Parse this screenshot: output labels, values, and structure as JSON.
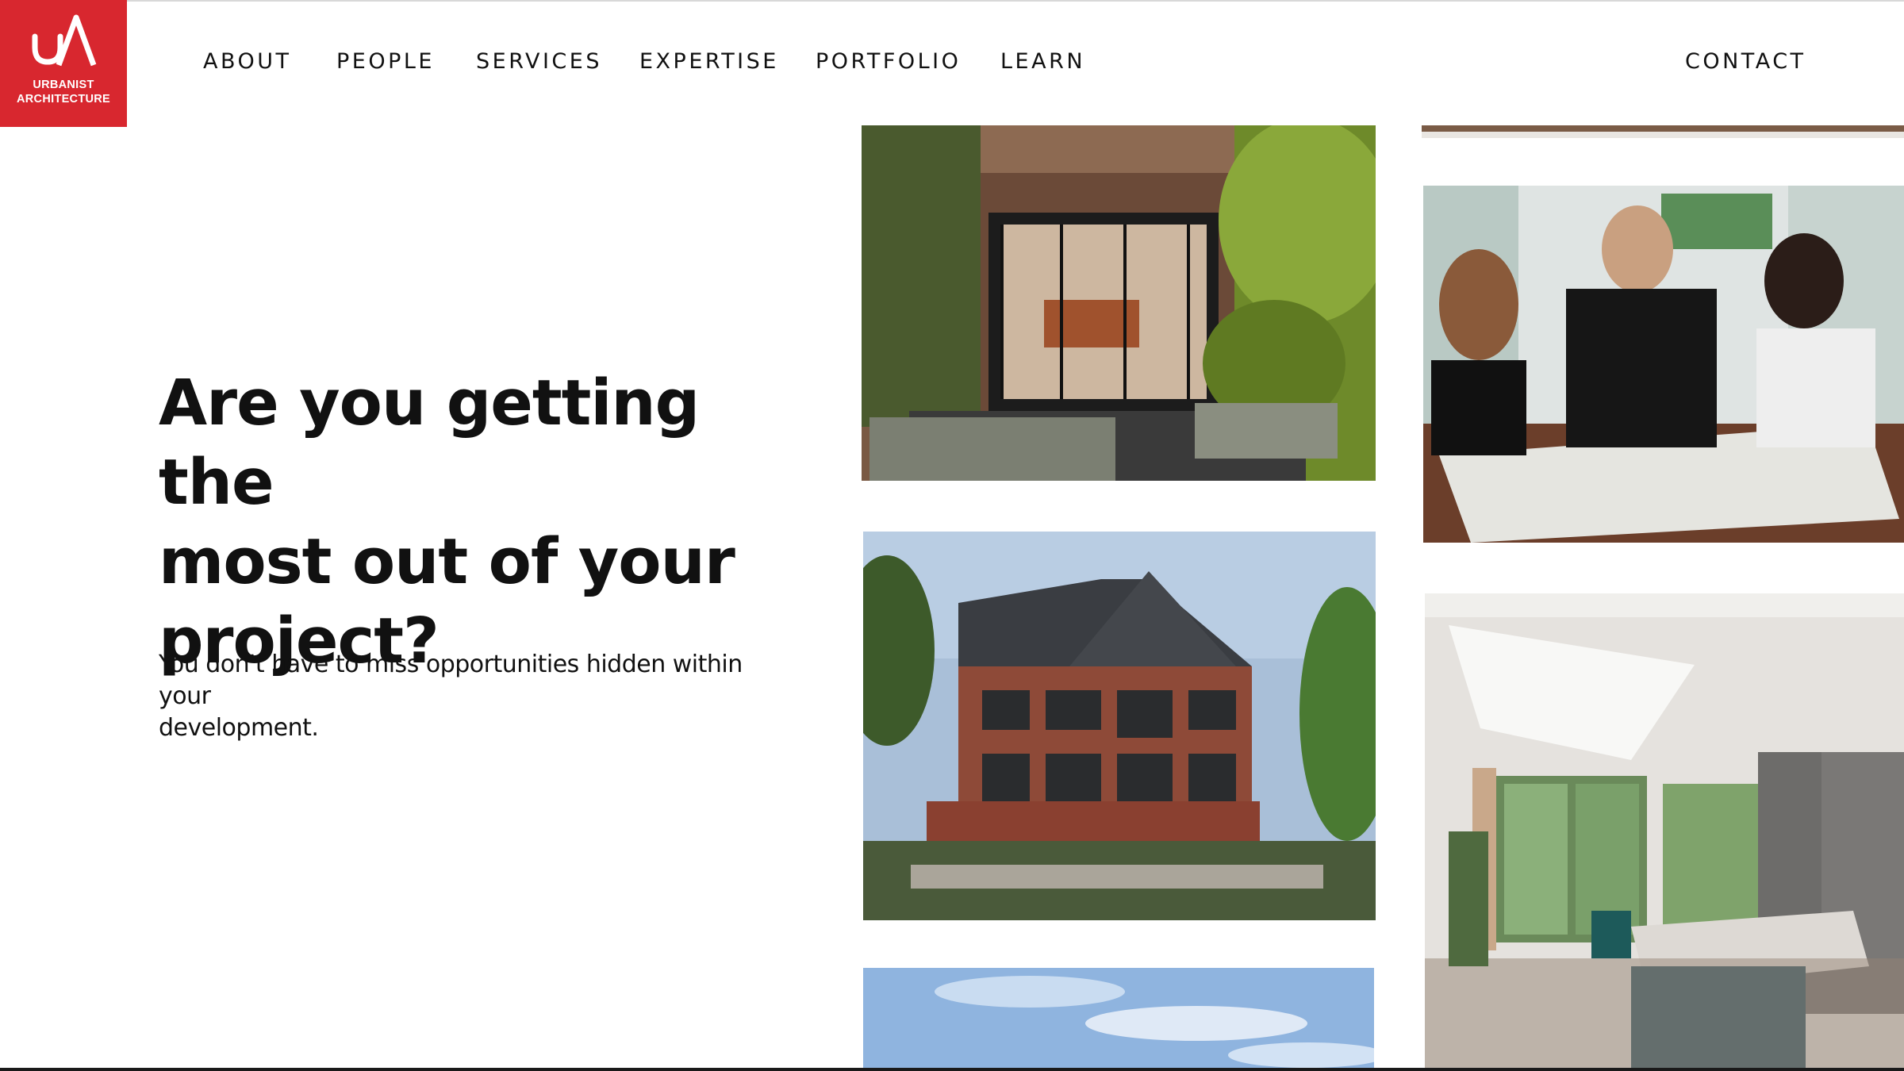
{
  "logo": {
    "line1": "URBANIST",
    "line2": "ARCHITECTURE",
    "brand_color": "#d8272f"
  },
  "nav": {
    "items": [
      {
        "label": "ABOUT"
      },
      {
        "label": "PEOPLE"
      },
      {
        "label": "SERVICES"
      },
      {
        "label": "EXPERTISE"
      },
      {
        "label": "PORTFOLIO"
      },
      {
        "label": "LEARN"
      }
    ],
    "contact": "CONTACT"
  },
  "hero": {
    "title_line1": "Are you getting the",
    "title_line2": "most out of your",
    "title_line3": "project?",
    "subtitle_line1": "You don't have to miss opportunities hidden within your",
    "subtitle_line2": "development."
  },
  "gallery": {
    "images": [
      {
        "icon": "house-extension-photo"
      },
      {
        "icon": "team-meeting-photo"
      },
      {
        "icon": "brick-residential-building-photo"
      },
      {
        "icon": "kitchen-interior-photo"
      },
      {
        "icon": "sky-photo"
      },
      {
        "icon": "ceiling-photo"
      }
    ]
  }
}
